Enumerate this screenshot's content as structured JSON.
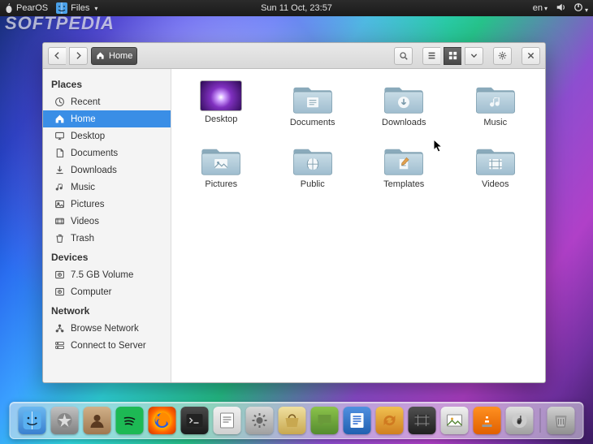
{
  "menubar": {
    "os_name": "PearOS",
    "files_menu": "Files",
    "clock": "Sun 11 Oct, 23:57",
    "lang": "en"
  },
  "watermark": "SOFTPEDIA",
  "window": {
    "path_label": "Home",
    "sidebar": {
      "sections": [
        {
          "title": "Places",
          "items": [
            {
              "icon": "recent",
              "label": "Recent"
            },
            {
              "icon": "home",
              "label": "Home",
              "active": true
            },
            {
              "icon": "desktop",
              "label": "Desktop"
            },
            {
              "icon": "document",
              "label": "Documents"
            },
            {
              "icon": "download",
              "label": "Downloads"
            },
            {
              "icon": "music",
              "label": "Music"
            },
            {
              "icon": "pictures",
              "label": "Pictures"
            },
            {
              "icon": "videos",
              "label": "Videos"
            },
            {
              "icon": "trash",
              "label": "Trash"
            }
          ]
        },
        {
          "title": "Devices",
          "items": [
            {
              "icon": "disk",
              "label": "7.5 GB Volume"
            },
            {
              "icon": "disk",
              "label": "Computer"
            }
          ]
        },
        {
          "title": "Network",
          "items": [
            {
              "icon": "network",
              "label": "Browse Network"
            },
            {
              "icon": "server",
              "label": "Connect to Server"
            }
          ]
        }
      ]
    },
    "grid": [
      {
        "icon": "desktop-thumb",
        "label": "Desktop"
      },
      {
        "icon": "documents",
        "label": "Documents"
      },
      {
        "icon": "downloads",
        "label": "Downloads"
      },
      {
        "icon": "music",
        "label": "Music"
      },
      {
        "icon": "pictures",
        "label": "Pictures"
      },
      {
        "icon": "public",
        "label": "Public"
      },
      {
        "icon": "templates",
        "label": "Templates"
      },
      {
        "icon": "videos",
        "label": "Videos"
      }
    ]
  },
  "dock": {
    "apps": [
      {
        "name": "finder",
        "bg": "linear-gradient(#6bb8f0,#3a80d0)"
      },
      {
        "name": "launchpad",
        "bg": "linear-gradient(#c0c0c0,#808080)"
      },
      {
        "name": "contacts",
        "bg": "linear-gradient(#d0b088,#a07850)"
      },
      {
        "name": "spotify",
        "bg": "#1db954"
      },
      {
        "name": "firefox",
        "bg": "radial-gradient(circle,#ffcc00 30%,#ff6600 60%,#cc3300)"
      },
      {
        "name": "terminal",
        "bg": "linear-gradient(#4a4a4a,#1a1a1a)"
      },
      {
        "name": "text-editor",
        "bg": "linear-gradient(#f0f0f0,#d0d0d0)"
      },
      {
        "name": "settings",
        "bg": "linear-gradient(#d8d8d8,#a0a0a0)"
      },
      {
        "name": "store",
        "bg": "linear-gradient(#f0e0a0,#c8a850)"
      },
      {
        "name": "chat",
        "bg": "linear-gradient(#8bc34a,#558b2f)"
      },
      {
        "name": "writer",
        "bg": "linear-gradient(#5090e0,#2060b0)"
      },
      {
        "name": "updater",
        "bg": "linear-gradient(#f0c050,#d08020)"
      },
      {
        "name": "movie",
        "bg": "linear-gradient(#505050,#202020)"
      },
      {
        "name": "photos-app",
        "bg": "linear-gradient(#f0f0f0,#c0c0c0)"
      },
      {
        "name": "vlc",
        "bg": "linear-gradient(#ff9020,#e06000)"
      },
      {
        "name": "music-player",
        "bg": "linear-gradient(#e0e0e0,#a0a0a0)"
      }
    ],
    "tray": [
      {
        "name": "trash-dock",
        "bg": "linear-gradient(#d0d0d0,#909090)"
      }
    ]
  }
}
